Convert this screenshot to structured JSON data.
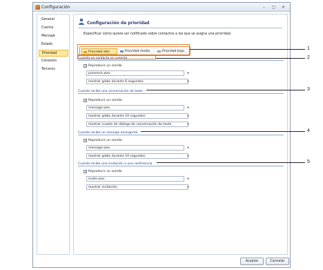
{
  "window": {
    "title": "Configuración",
    "controls": [
      "–",
      "▢",
      "✕"
    ]
  },
  "sidebar": {
    "items": [
      {
        "label": "General"
      },
      {
        "label": "Cuenta"
      },
      {
        "label": "Mensaje"
      },
      {
        "label": "Estado"
      },
      {
        "label": "Prioridad"
      },
      {
        "label": "Conexión"
      },
      {
        "label": "Terceros"
      }
    ],
    "active_index": 4
  },
  "header": {
    "title": "Configuración de prioridad",
    "description": "Especificar cómo quiere ser notificado sobre contactos a los que se asigna una prioridad."
  },
  "tabs": [
    {
      "label": "Prioridad alta",
      "color": "#e0a020"
    },
    {
      "label": "Prioridad media",
      "color": "#6c8ebf"
    },
    {
      "label": "Prioridad bajo",
      "color": "#9aa6b5"
    }
  ],
  "sections": [
    {
      "heading": "Cuando un contacto se conecta",
      "check_label": "Reproducir un sonido",
      "sound_file": "presence.wav",
      "dropdowns": [
        "mostrar globo durante 6 segundos"
      ]
    },
    {
      "heading": "Cuando recibe una conversación de texto",
      "check_label": "Reproducir un sonido",
      "sound_file": "message.wav",
      "dropdowns": [
        "mostrar globo durante 10 segundos",
        "mostrar cuadro de diálogo de conversación de texto"
      ]
    },
    {
      "heading": "Cuando recibe un mensaje emergente",
      "check_label": "Reproducir un sonido",
      "sound_file": "message.wav",
      "dropdowns": [
        "mostrar globo durante 10 segundos"
      ]
    },
    {
      "heading": "Cuando recibe una invitación a una conferencia",
      "check_label": "Reproducir un sonido",
      "sound_file": "invite.wav",
      "dropdowns": [
        "mostrar invitación"
      ]
    }
  ],
  "footer": {
    "accept_label": "Aceptar",
    "cancel_label": "Cancelar"
  },
  "callouts": [
    "1",
    "2",
    "3",
    "4",
    "5"
  ],
  "colors": {
    "accent_active": "#fde89a",
    "highlight_box": "#e07b2a",
    "section_heading": "#1e3a7a"
  }
}
